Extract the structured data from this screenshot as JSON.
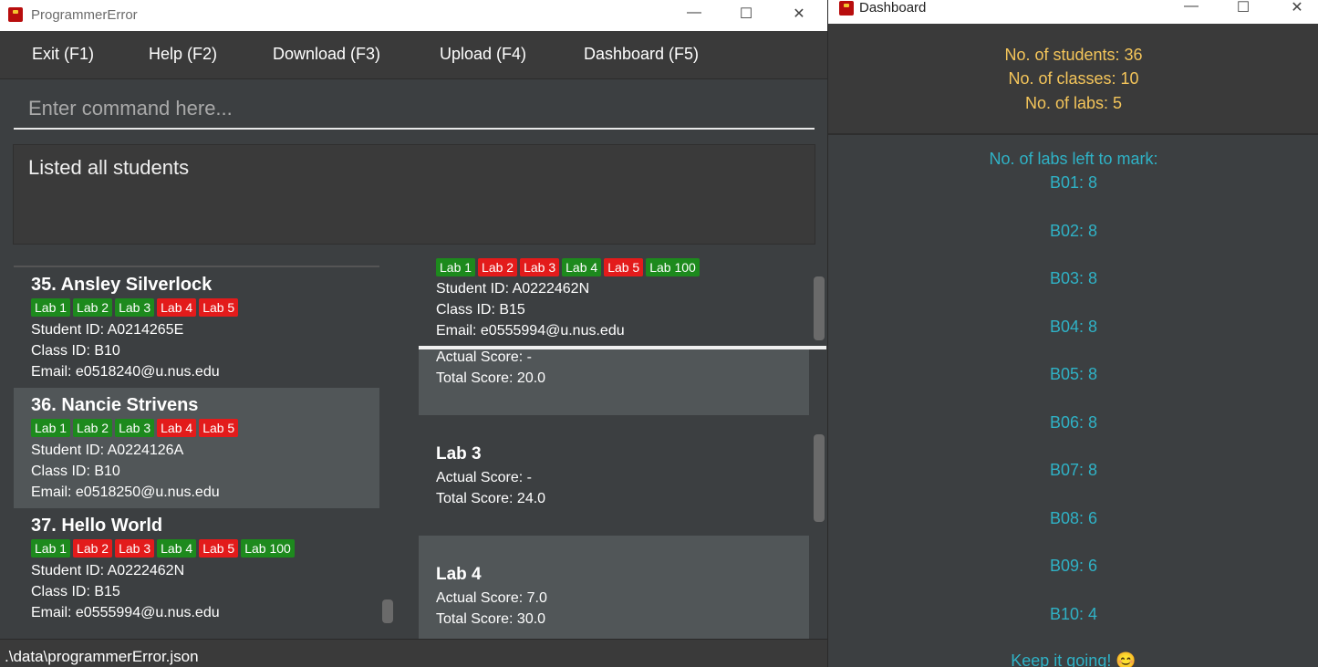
{
  "main_window": {
    "title": "ProgrammerError",
    "controls": {
      "minimize": "—",
      "maximize": "☐",
      "close": "✕"
    },
    "menu": [
      "Exit (F1)",
      "Help (F2)",
      "Download (F3)",
      "Upload (F4)",
      "Dashboard (F5)"
    ],
    "command_placeholder": "Enter command here...",
    "result": "Listed all students",
    "status": ".\\data\\programmerError.json"
  },
  "students": [
    {
      "name": "35.  Ansley Silverlock",
      "labs": [
        {
          "label": "Lab 1",
          "status": "green"
        },
        {
          "label": "Lab 2",
          "status": "green"
        },
        {
          "label": "Lab 3",
          "status": "green"
        },
        {
          "label": "Lab 4",
          "status": "red"
        },
        {
          "label": "Lab 5",
          "status": "red"
        }
      ],
      "student_id": "Student ID: A0214265E",
      "class_id": "Class ID: B10",
      "email": "Email: e0518240@u.nus.edu"
    },
    {
      "name": "36.  Nancie Strivens",
      "labs": [
        {
          "label": "Lab 1",
          "status": "green"
        },
        {
          "label": "Lab 2",
          "status": "green"
        },
        {
          "label": "Lab 3",
          "status": "green"
        },
        {
          "label": "Lab 4",
          "status": "red"
        },
        {
          "label": "Lab 5",
          "status": "red"
        }
      ],
      "student_id": "Student ID: A0224126A",
      "class_id": "Class ID: B10",
      "email": "Email: e0518250@u.nus.edu"
    },
    {
      "name": "37.  Hello World",
      "labs": [
        {
          "label": "Lab 1",
          "status": "green"
        },
        {
          "label": "Lab 2",
          "status": "red"
        },
        {
          "label": "Lab 3",
          "status": "red"
        },
        {
          "label": "Lab 4",
          "status": "green"
        },
        {
          "label": "Lab 5",
          "status": "red"
        },
        {
          "label": "Lab 100",
          "status": "green"
        }
      ],
      "student_id": "Student ID: A0222462N",
      "class_id": "Class ID: B15",
      "email": "Email: e0555994@u.nus.edu"
    }
  ],
  "selected_student_popup": {
    "labs": [
      {
        "label": "Lab 1",
        "status": "green"
      },
      {
        "label": "Lab 2",
        "status": "red"
      },
      {
        "label": "Lab 3",
        "status": "red"
      },
      {
        "label": "Lab 4",
        "status": "green"
      },
      {
        "label": "Lab 5",
        "status": "red"
      },
      {
        "label": "Lab 100",
        "status": "green"
      }
    ],
    "student_id": "Student ID: A0222462N",
    "class_id": "Class ID: B15",
    "email": "Email: e0555994@u.nus.edu"
  },
  "lab_results": [
    {
      "title": "",
      "actual": "Actual Score: -",
      "total": "Total Score: 20.0"
    },
    {
      "title": "Lab 3",
      "actual": "Actual Score: -",
      "total": "Total Score: 24.0"
    },
    {
      "title": "Lab 4",
      "actual": "Actual Score: 7.0",
      "total": "Total Score: 30.0"
    }
  ],
  "dashboard": {
    "title": "Dashboard",
    "summary": [
      "No. of students: 36",
      "No. of classes: 10",
      "No. of labs: 5"
    ],
    "labs_left_heading": "No. of labs left to mark:",
    "classes": [
      "B01: 8",
      "B02: 8",
      "B03: 8",
      "B04: 8",
      "B05: 8",
      "B06: 8",
      "B07: 8",
      "B08: 6",
      "B09: 6",
      "B10: 4"
    ],
    "footer": "Keep it going! 😊"
  },
  "colors": {
    "tag_green": "#1d8a1d",
    "tag_red": "#e31b1b",
    "summary_text": "#f4c55a",
    "dashboard_blue": "#2fb2c6",
    "panel_bg": "#3c3f41",
    "selected_card": "#515658"
  }
}
